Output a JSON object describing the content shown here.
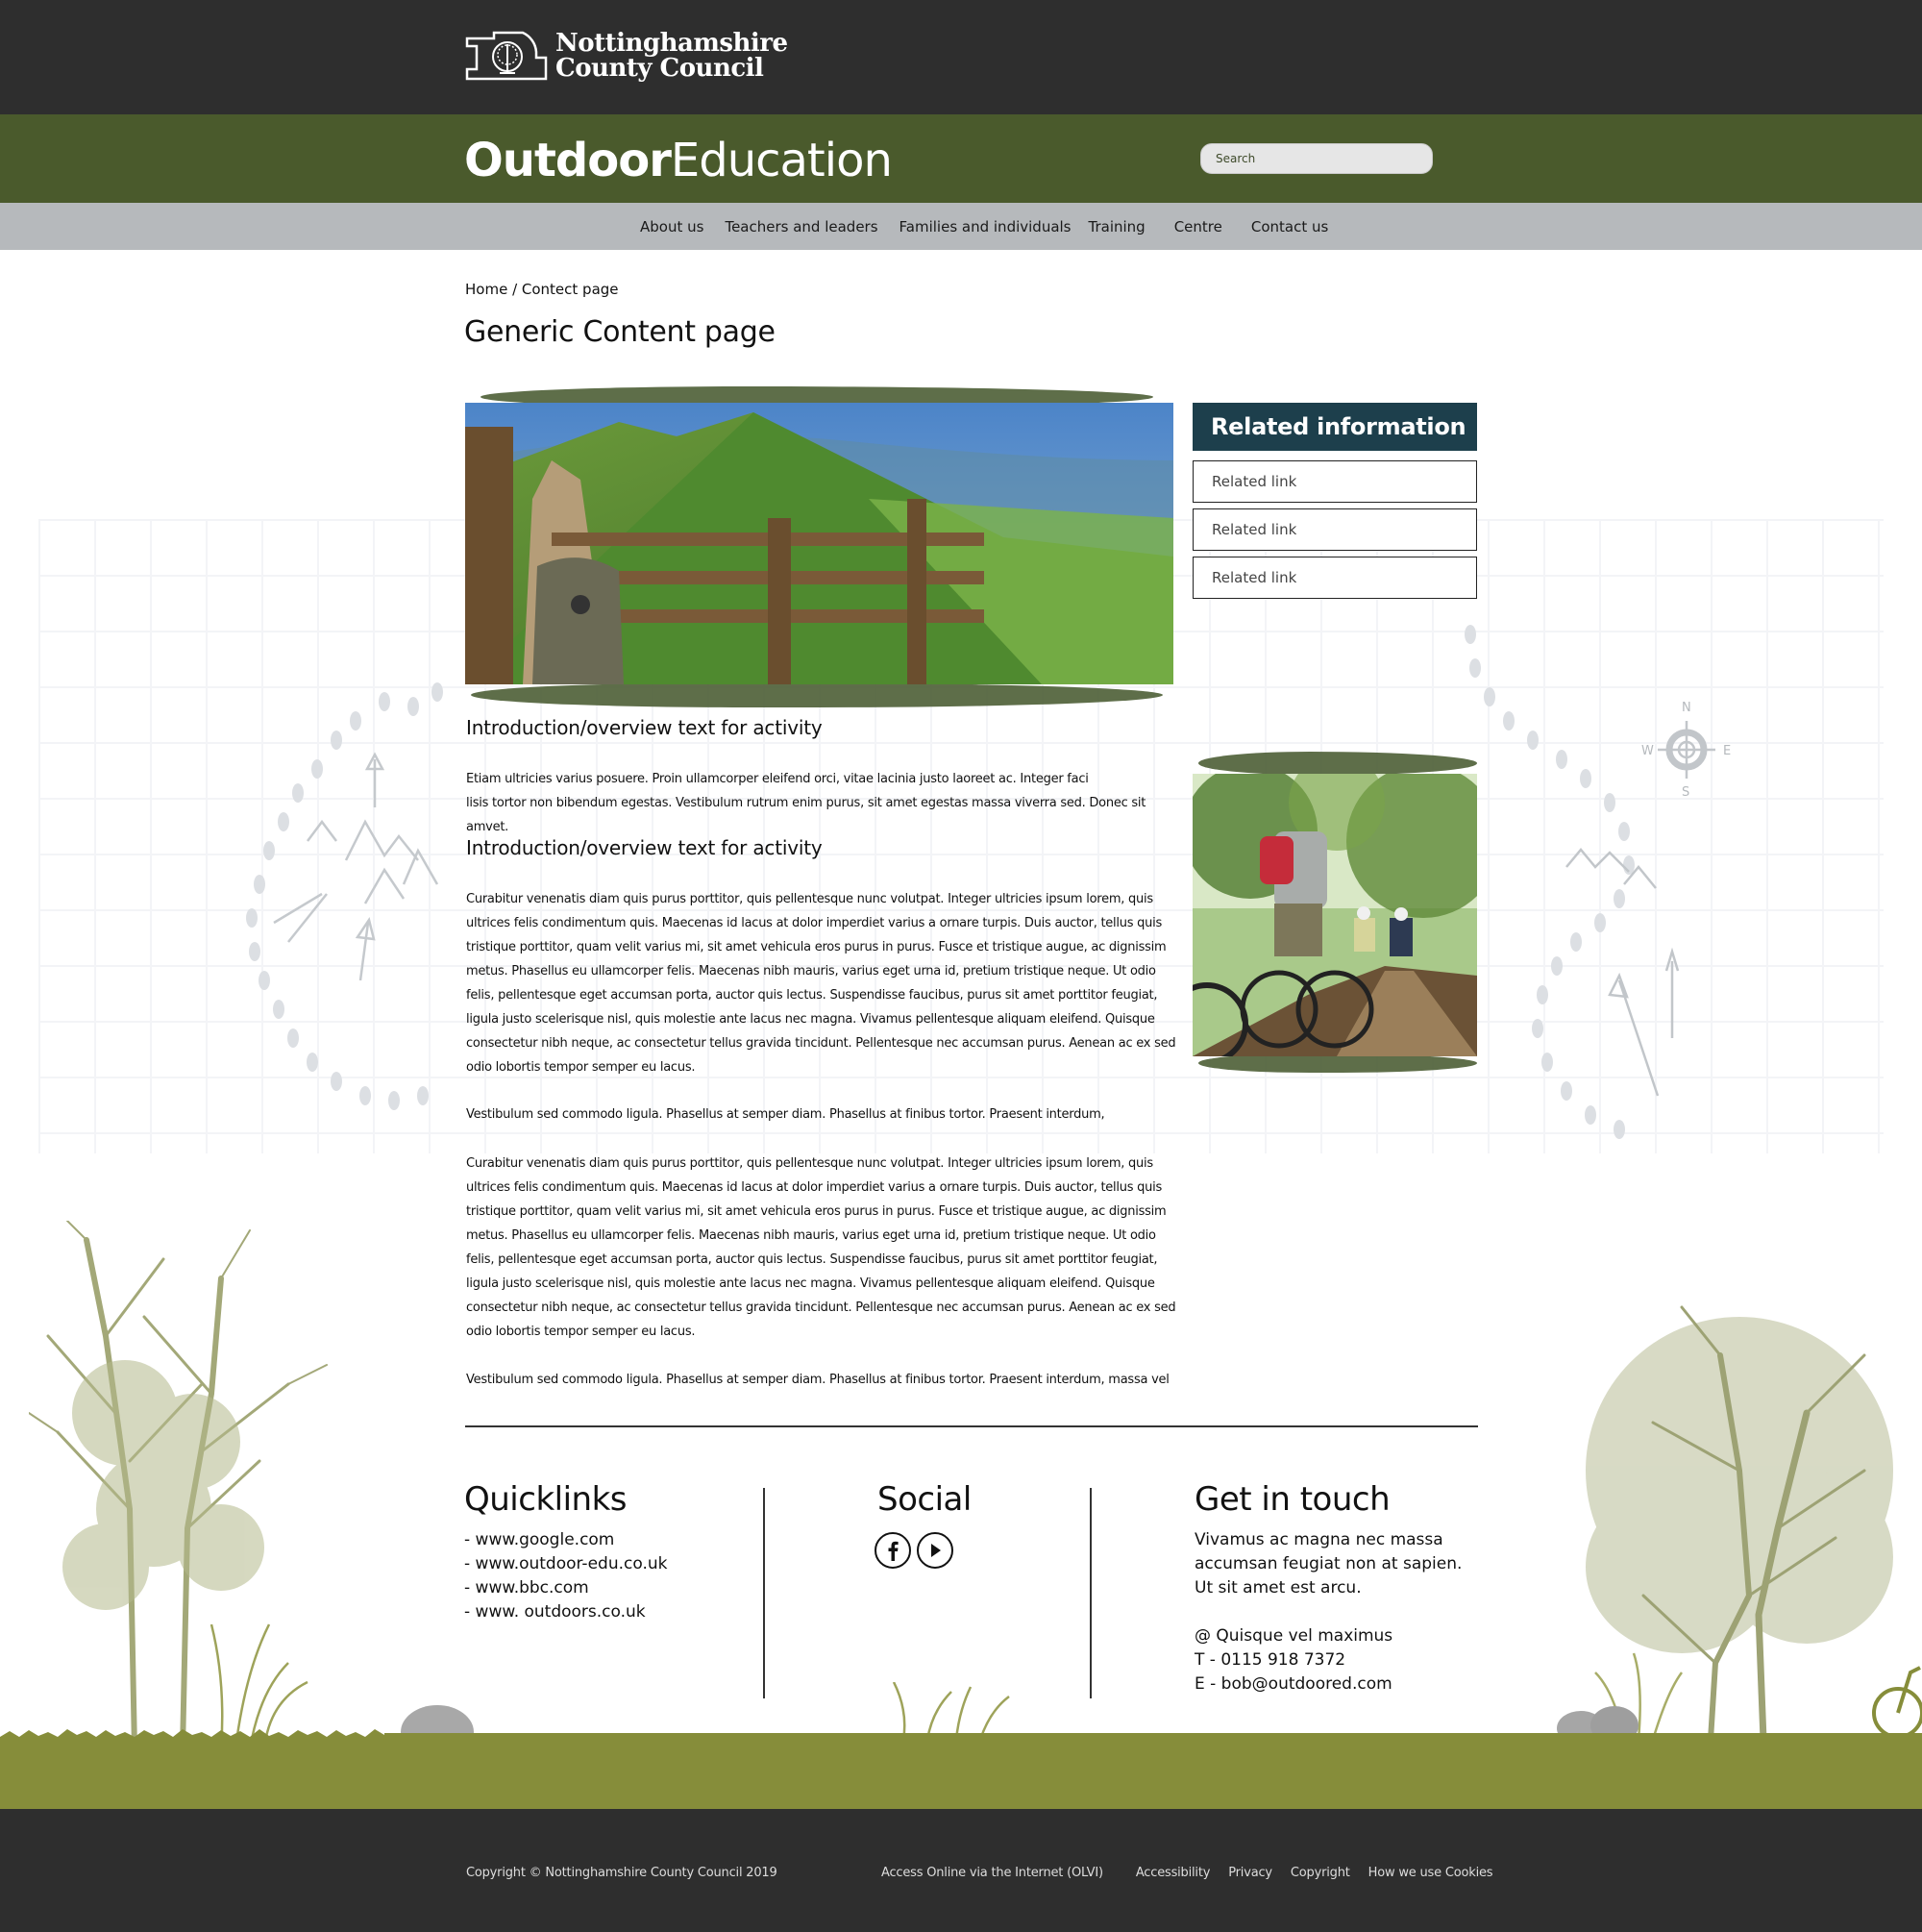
{
  "council": {
    "name_line1": "Nottinghamshire",
    "name_line2": "County Council"
  },
  "brand": {
    "title_bold": "Outdoor",
    "title_light": "Education"
  },
  "search": {
    "placeholder": "Search",
    "value": ""
  },
  "nav": {
    "items": [
      {
        "label": "About us"
      },
      {
        "label": "Teachers and leaders"
      },
      {
        "label": "Families and individuals"
      },
      {
        "label": "Training"
      },
      {
        "label": "Centre"
      },
      {
        "label": "Contact us"
      }
    ]
  },
  "breadcrumb": {
    "home": "Home",
    "separator": " / ",
    "current": "Contect page"
  },
  "page": {
    "title": "Generic Content page"
  },
  "images": {
    "hero": "hill-path-stile-photo",
    "side": "forest-cyclists-photo"
  },
  "sidebar": {
    "heading": "Related information",
    "links": [
      {
        "label": "Related link"
      },
      {
        "label": "Related link"
      },
      {
        "label": "Related link"
      }
    ]
  },
  "article": {
    "heading1": "Introduction/overview text for activity",
    "intro_line1": "Etiam ultricies varius posuere. Proin ullamcorper eleifend orci, vitae lacinia justo laoreet ac. Integer faci",
    "intro_line2": "lisis tortor non bibendum egestas. Vestibulum rutrum enim purus, sit amet egestas massa viverra sed. Donec sit amvet.",
    "heading2": "Introduction/overview text for activity",
    "para_a": " Curabitur venenatis diam quis purus porttitor, quis pellentesque nunc volutpat. Integer ultricies ipsum lorem, quis ultrices felis condimentum quis. Maecenas id lacus at dolor imperdiet varius a ornare turpis. Duis auctor, tellus quis tristique porttitor, quam velit varius mi, sit amet vehicula eros purus in purus. Fusce et tristique augue, ac dignissim metus. Phasellus eu ullamcorper felis. Maecenas nibh mauris, varius eget urna id, pretium tristique neque. Ut odio felis, pellentesque eget accumsan porta, auctor quis lectus. Suspendisse faucibus, purus sit amet porttitor feugiat, ligula justo scelerisque nisl, quis molestie ante lacus nec magna. Vivamus pellentesque aliquam eleifend. Quisque consectetur nibh neque, ac consectetur tellus gravida tincidunt. Pellentesque nec accumsan purus. Aenean ac ex sed odio lobortis tempor semper eu lacus.",
    "para_b": "Vestibulum sed commodo ligula. Phasellus at semper diam. Phasellus at finibus tortor. Praesent interdum,",
    "para_c": "Curabitur venenatis diam quis purus porttitor, quis pellentesque nunc volutpat. Integer ultricies ipsum lorem, quis ultrices felis condimentum quis. Maecenas id lacus at dolor imperdiet varius a ornare turpis. Duis auctor, tellus quis tristique porttitor, quam velit varius mi, sit amet vehicula eros purus in purus. Fusce et tristique augue, ac dignissim metus. Phasellus eu ullamcorper felis. Maecenas nibh mauris, varius eget urna id, pretium tristique neque. Ut odio felis, pellentesque eget accumsan porta, auctor quis lectus. Suspendisse faucibus, purus sit amet porttitor feugiat, ligula justo scelerisque nisl, quis molestie ante lacus nec magna. Vivamus pellentesque aliquam eleifend. Quisque consectetur nibh neque, ac consectetur tellus gravida tincidunt. Pellentesque nec accumsan purus. Aenean ac ex sed odio lobortis tempor semper eu lacus.",
    "para_d": "Vestibulum sed commodo ligula. Phasellus at semper diam. Phasellus at finibus tortor. Praesent interdum, massa vel"
  },
  "footer": {
    "quicklinks": {
      "heading": "Quicklinks",
      "items": [
        {
          "label": "- www.google.com"
        },
        {
          "label": "- www.outdoor-edu.co.uk"
        },
        {
          "label": "- www.bbc.com"
        },
        {
          "label": "- www. outdoors.co.uk"
        }
      ]
    },
    "social": {
      "heading": "Social",
      "icons": [
        "facebook-icon",
        "youtube-play-icon"
      ]
    },
    "contact": {
      "heading": "Get in touch",
      "text": "Vivamus ac magna nec massa accumsan feugiat non at sapien. Ut sit amet est arcu.",
      "address": "@ Quisque vel maximus",
      "phone": "T - 0115 918 7372",
      "email": "E - bob@outdoored.com"
    }
  },
  "bottom": {
    "copyright": "Copyright © Nottinghamshire County Council 2019",
    "links": [
      {
        "label": "Access Online via the Internet (OLVI)"
      },
      {
        "label": "Accessibility"
      },
      {
        "label": "Privacy"
      },
      {
        "label": "Copyright"
      },
      {
        "label": "How we use Cookies"
      }
    ]
  },
  "colors": {
    "council_bar": "#2e2e2e",
    "brand_green": "#4a5a2c",
    "nav_grey": "#b6b9bc",
    "related_heading": "#1d3f4c",
    "grass": "#868d3a"
  }
}
